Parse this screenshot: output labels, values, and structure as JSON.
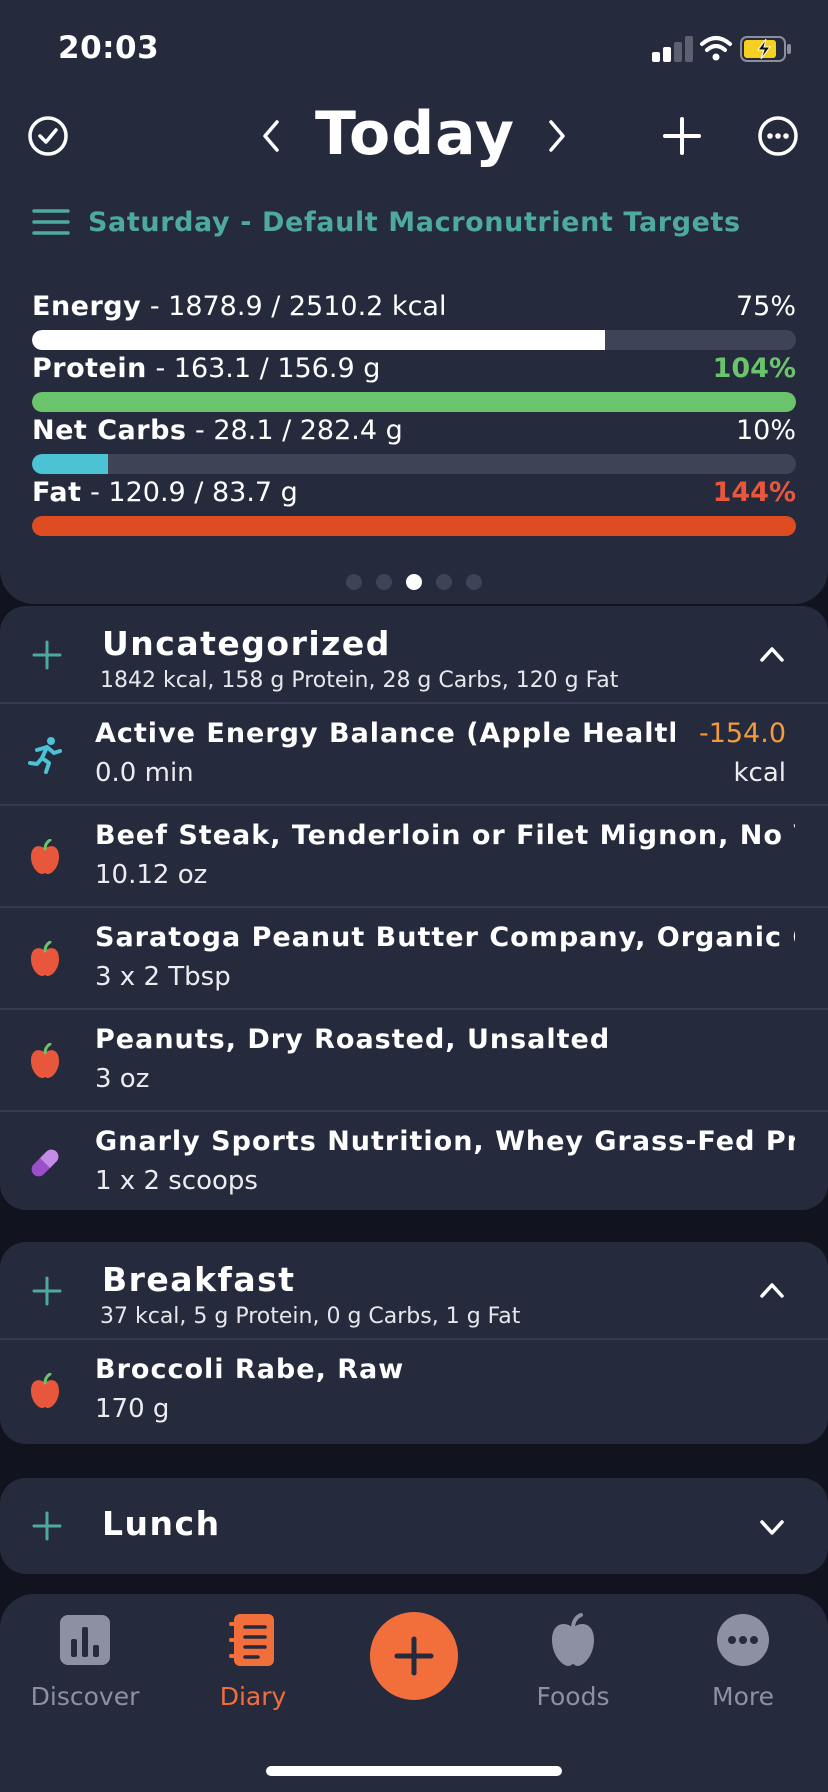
{
  "status": {
    "time": "20:03"
  },
  "header": {
    "title": "Today"
  },
  "targets": {
    "label": "Saturday - Default Macronutrient Targets"
  },
  "macros": [
    {
      "name": "Energy",
      "detail": " - 1878.9 / 2510.2 kcal",
      "percent": "75%",
      "fill": 0.75,
      "color": "#ffffff",
      "pct_color": "#ffffff"
    },
    {
      "name": "Protein",
      "detail": " - 163.1 / 156.9 g",
      "percent": "104%",
      "fill": 1.0,
      "color": "#6ac46b",
      "pct_color": "#6ac46b"
    },
    {
      "name": "Net Carbs",
      "detail": " - 28.1 / 282.4 g",
      "percent": "10%",
      "fill": 0.1,
      "color": "#4cc3d5",
      "pct_color": "#ffffff"
    },
    {
      "name": "Fat",
      "detail": " - 120.9 / 83.7 g",
      "percent": "144%",
      "fill": 1.0,
      "color": "#e04c22",
      "pct_color": "#e8573c"
    }
  ],
  "pager": {
    "count": 5,
    "active": 2
  },
  "uncategorized": {
    "title": "Uncategorized",
    "summary": "1842 kcal, 158 g Protein, 28 g Carbs, 120 g Fat",
    "entries": [
      {
        "name": "Active Energy Balance (Apple Health)",
        "amount": "0.0 min",
        "value": "-154.0",
        "unit": "kcal",
        "icon": "running-icon"
      },
      {
        "name": "Beef Steak, Tenderloin or Filet Mignon, No Visib…",
        "amount": "10.12 oz",
        "icon": "apple-icon"
      },
      {
        "name": "Saratoga Peanut Butter Company, Organic Old …",
        "amount": "3 x 2 Tbsp",
        "icon": "apple-icon"
      },
      {
        "name": "Peanuts, Dry Roasted, Unsalted",
        "amount": "3 oz",
        "icon": "apple-icon"
      },
      {
        "name": "Gnarly Sports Nutrition, Whey Grass-Fed Prote…",
        "amount": "1 x 2 scoops",
        "icon": "pill-icon"
      }
    ]
  },
  "breakfast": {
    "title": "Breakfast",
    "summary": "37 kcal, 5 g Protein, 0 g Carbs, 1 g Fat",
    "entries": [
      {
        "name": "Broccoli Rabe, Raw",
        "amount": "170 g",
        "icon": "apple-icon"
      }
    ]
  },
  "lunch": {
    "title": "Lunch"
  },
  "tabs": [
    {
      "label": "Discover",
      "icon": "chart-icon"
    },
    {
      "label": "Diary",
      "icon": "notebook-icon"
    },
    {
      "label": "Foods",
      "icon": "apple-icon"
    },
    {
      "label": "More",
      "icon": "more-icon"
    }
  ]
}
